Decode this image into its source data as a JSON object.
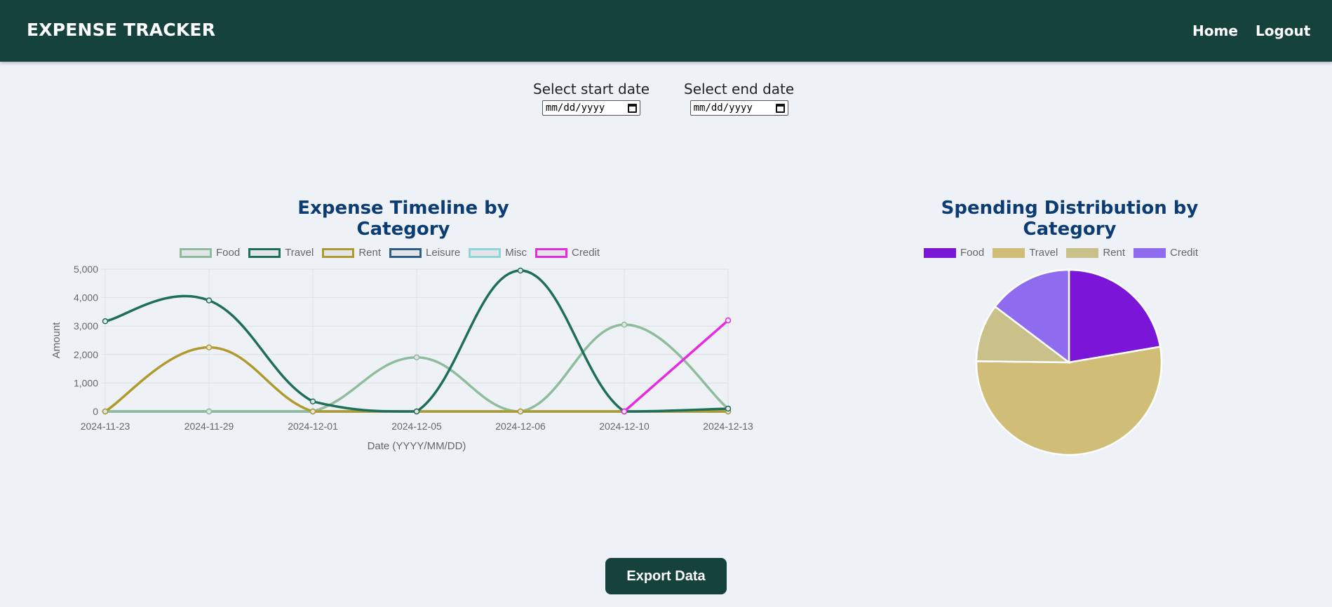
{
  "navbar": {
    "brand": "EXPENSE TRACKER",
    "home": "Home",
    "logout": "Logout"
  },
  "filters": {
    "start": {
      "label": "Select start date",
      "placeholder": "mm/dd/yyyy"
    },
    "end": {
      "label": "Select end date",
      "placeholder": "mm/dd/yyyy"
    }
  },
  "export_label": "Export Data",
  "chart_data": [
    {
      "type": "line",
      "title": "Expense Timeline by Category",
      "xlabel": "Date (YYYY/MM/DD)",
      "ylabel": "Amount",
      "ylim": [
        0,
        5000
      ],
      "yticks": [
        0,
        1000,
        2000,
        3000,
        4000,
        5000
      ],
      "categories": [
        "2024-11-23",
        "2024-11-29",
        "2024-12-01",
        "2024-12-05",
        "2024-12-06",
        "2024-12-10",
        "2024-12-13"
      ],
      "grid": true,
      "legend": "top",
      "series": [
        {
          "name": "Food",
          "color": "#8fbc9a",
          "values": [
            0,
            0,
            0,
            1900,
            0,
            3050,
            100
          ]
        },
        {
          "name": "Travel",
          "color": "#1f6e5a",
          "values": [
            3170,
            3900,
            350,
            0,
            4950,
            0,
            100
          ]
        },
        {
          "name": "Rent",
          "color": "#b09a2e",
          "values": [
            0,
            2250,
            0,
            0,
            0,
            0,
            0
          ]
        },
        {
          "name": "Leisure",
          "color": "#2d5f86",
          "values": [
            0,
            0,
            0,
            0,
            0,
            0,
            0
          ]
        },
        {
          "name": "Misc",
          "color": "#8fd6d6",
          "values": [
            0,
            0,
            0,
            0,
            0,
            0,
            0
          ]
        },
        {
          "name": "Credit",
          "color": "#e62ce0",
          "values": [
            null,
            null,
            null,
            null,
            null,
            0,
            3200
          ]
        }
      ]
    },
    {
      "type": "pie",
      "title": "Spending Distribution by Category",
      "legend": "top",
      "labels": [
        "Food",
        "Travel",
        "Rent",
        "Credit"
      ],
      "values": [
        22.3,
        52.9,
        10.1,
        14.7
      ],
      "colors": [
        "#7b16d9",
        "#cfbd78",
        "#c9c08a",
        "#8f6bf0"
      ]
    }
  ]
}
